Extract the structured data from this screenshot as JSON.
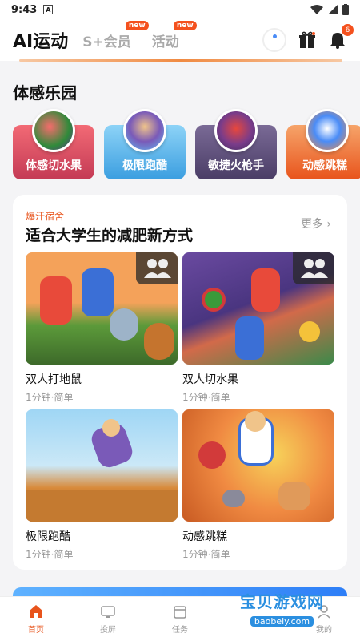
{
  "status_bar": {
    "time": "9:43",
    "app_icon": "A"
  },
  "header": {
    "tabs": [
      {
        "label": "AI运动",
        "active": true
      },
      {
        "label": "S+会员",
        "badge": "new"
      },
      {
        "label": "活动",
        "badge": "new"
      }
    ],
    "notification_count": "6",
    "icons": [
      "ring-icon",
      "gift-icon",
      "bell-icon"
    ]
  },
  "motion_section": {
    "title": "体感乐园",
    "games": [
      {
        "label": "体感切水果",
        "color_from": "#f05a68",
        "color_to": "#c0304a"
      },
      {
        "label": "极限跑酷",
        "color_from": "#7bc9f5",
        "color_to": "#3b9ee0"
      },
      {
        "label": "敏捷火枪手",
        "color_from": "#6d5c8a",
        "color_to": "#4a3d66"
      },
      {
        "label": "动感跳糕",
        "color_from": "#f49354",
        "color_to": "#e8541c"
      }
    ]
  },
  "dorm_card": {
    "tag": "爆汗宿舍",
    "title": "适合大学生的减肥新方式",
    "more": "更多",
    "tiles": [
      {
        "name": "双人打地鼠",
        "meta": "1分钟·简单",
        "duo": true
      },
      {
        "name": "双人切水果",
        "meta": "1分钟·简单",
        "duo": true
      },
      {
        "name": "极限跑酷",
        "meta": "1分钟·简单",
        "duo": false
      },
      {
        "name": "动感跳糕",
        "meta": "1分钟·简单",
        "duo": false
      }
    ]
  },
  "bottom_nav": [
    {
      "label": "首页",
      "icon": "home-icon",
      "active": true
    },
    {
      "label": "投屏",
      "icon": "tv-icon",
      "active": false
    },
    {
      "label": "任务",
      "icon": "calendar-icon",
      "active": false
    },
    {
      "label": "",
      "icon": "",
      "active": false
    },
    {
      "label": "我的",
      "icon": "profile-icon",
      "active": false
    }
  ],
  "watermark": {
    "text": "宝贝游戏网",
    "url": "baobeiy.com"
  },
  "colors": {
    "accent": "#e8541c",
    "badge": "#f4511e"
  }
}
